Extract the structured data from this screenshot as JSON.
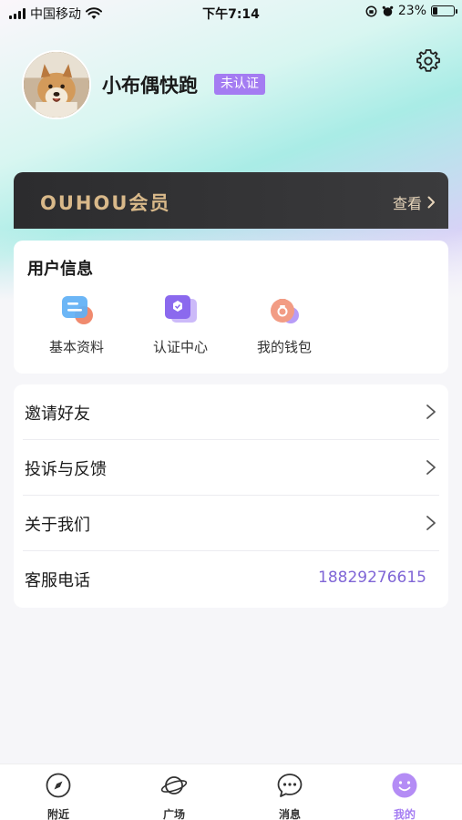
{
  "status_bar": {
    "carrier": "中国移动",
    "time": "下午7:14",
    "battery": "23%",
    "battery_level": 0.23
  },
  "profile": {
    "name": "小布偶快跑",
    "verify_badge": "未认证"
  },
  "vip": {
    "title": "OUHOU会员",
    "view_label": "查看"
  },
  "user_info": {
    "title": "用户信息",
    "items": [
      {
        "label": "基本资料",
        "icon": "profile-card-icon"
      },
      {
        "label": "认证中心",
        "icon": "verify-badge-icon"
      },
      {
        "label": "我的钱包",
        "icon": "wallet-icon"
      }
    ]
  },
  "menu": {
    "items": [
      {
        "label": "邀请好友"
      },
      {
        "label": "投诉与反馈"
      },
      {
        "label": "关于我们"
      }
    ],
    "service": {
      "label": "客服电话",
      "phone": "18829276615"
    }
  },
  "tabs": [
    {
      "label": "附近",
      "icon": "compass-icon"
    },
    {
      "label": "广场",
      "icon": "planet-icon"
    },
    {
      "label": "消息",
      "icon": "chat-bubble-icon"
    },
    {
      "label": "我的",
      "icon": "smiley-icon",
      "active": true
    }
  ],
  "colors": {
    "accent": "#a47cf2",
    "vip_gold": "#d9b98a",
    "phone": "#8066d6"
  }
}
